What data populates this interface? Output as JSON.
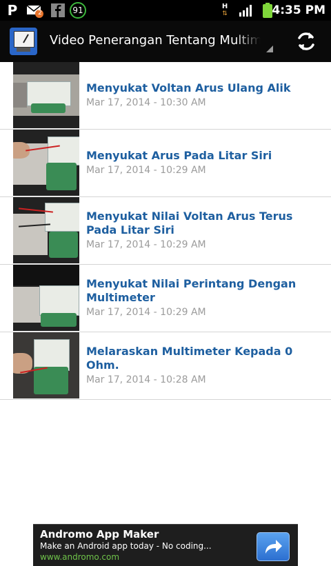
{
  "status_bar": {
    "time": "4:35 PM",
    "p_letter": "P",
    "mail_badge": "2",
    "battery_level": "91",
    "network": "H"
  },
  "action_bar": {
    "title": "Video Penerangan Tentang Multimeter",
    "icons": [
      "app-logo-icon",
      "dropdown-indicator-icon",
      "refresh-icon"
    ]
  },
  "videos": [
    {
      "title": "Menyukat Voltan Arus Ulang Alik",
      "date": "Mar 17, 2014 - 10:30 AM"
    },
    {
      "title": "Menyukat Arus Pada Litar Siri",
      "date": "Mar 17, 2014 - 10:29 AM"
    },
    {
      "title": "Menyukat Nilai Voltan Arus Terus Pada Litar Siri",
      "date": "Mar 17, 2014 - 10:29 AM"
    },
    {
      "title": "Menyukat Nilai Perintang Dengan Multimeter",
      "date": "Mar 17, 2014 - 10:29 AM"
    },
    {
      "title": "Melaraskan Multimeter Kepada 0 Ohm.",
      "date": "Mar 17, 2014 - 10:28 AM"
    }
  ],
  "ad": {
    "title": "Andromo App Maker",
    "subtitle": "Make an Android app today - No coding...",
    "url": "www.andromo.com",
    "button_icon": "share-arrow-icon"
  },
  "colors": {
    "title_blue": "#1e5fa0",
    "date_gray": "#9b9b9b",
    "ad_url_green": "#6fc34a"
  }
}
